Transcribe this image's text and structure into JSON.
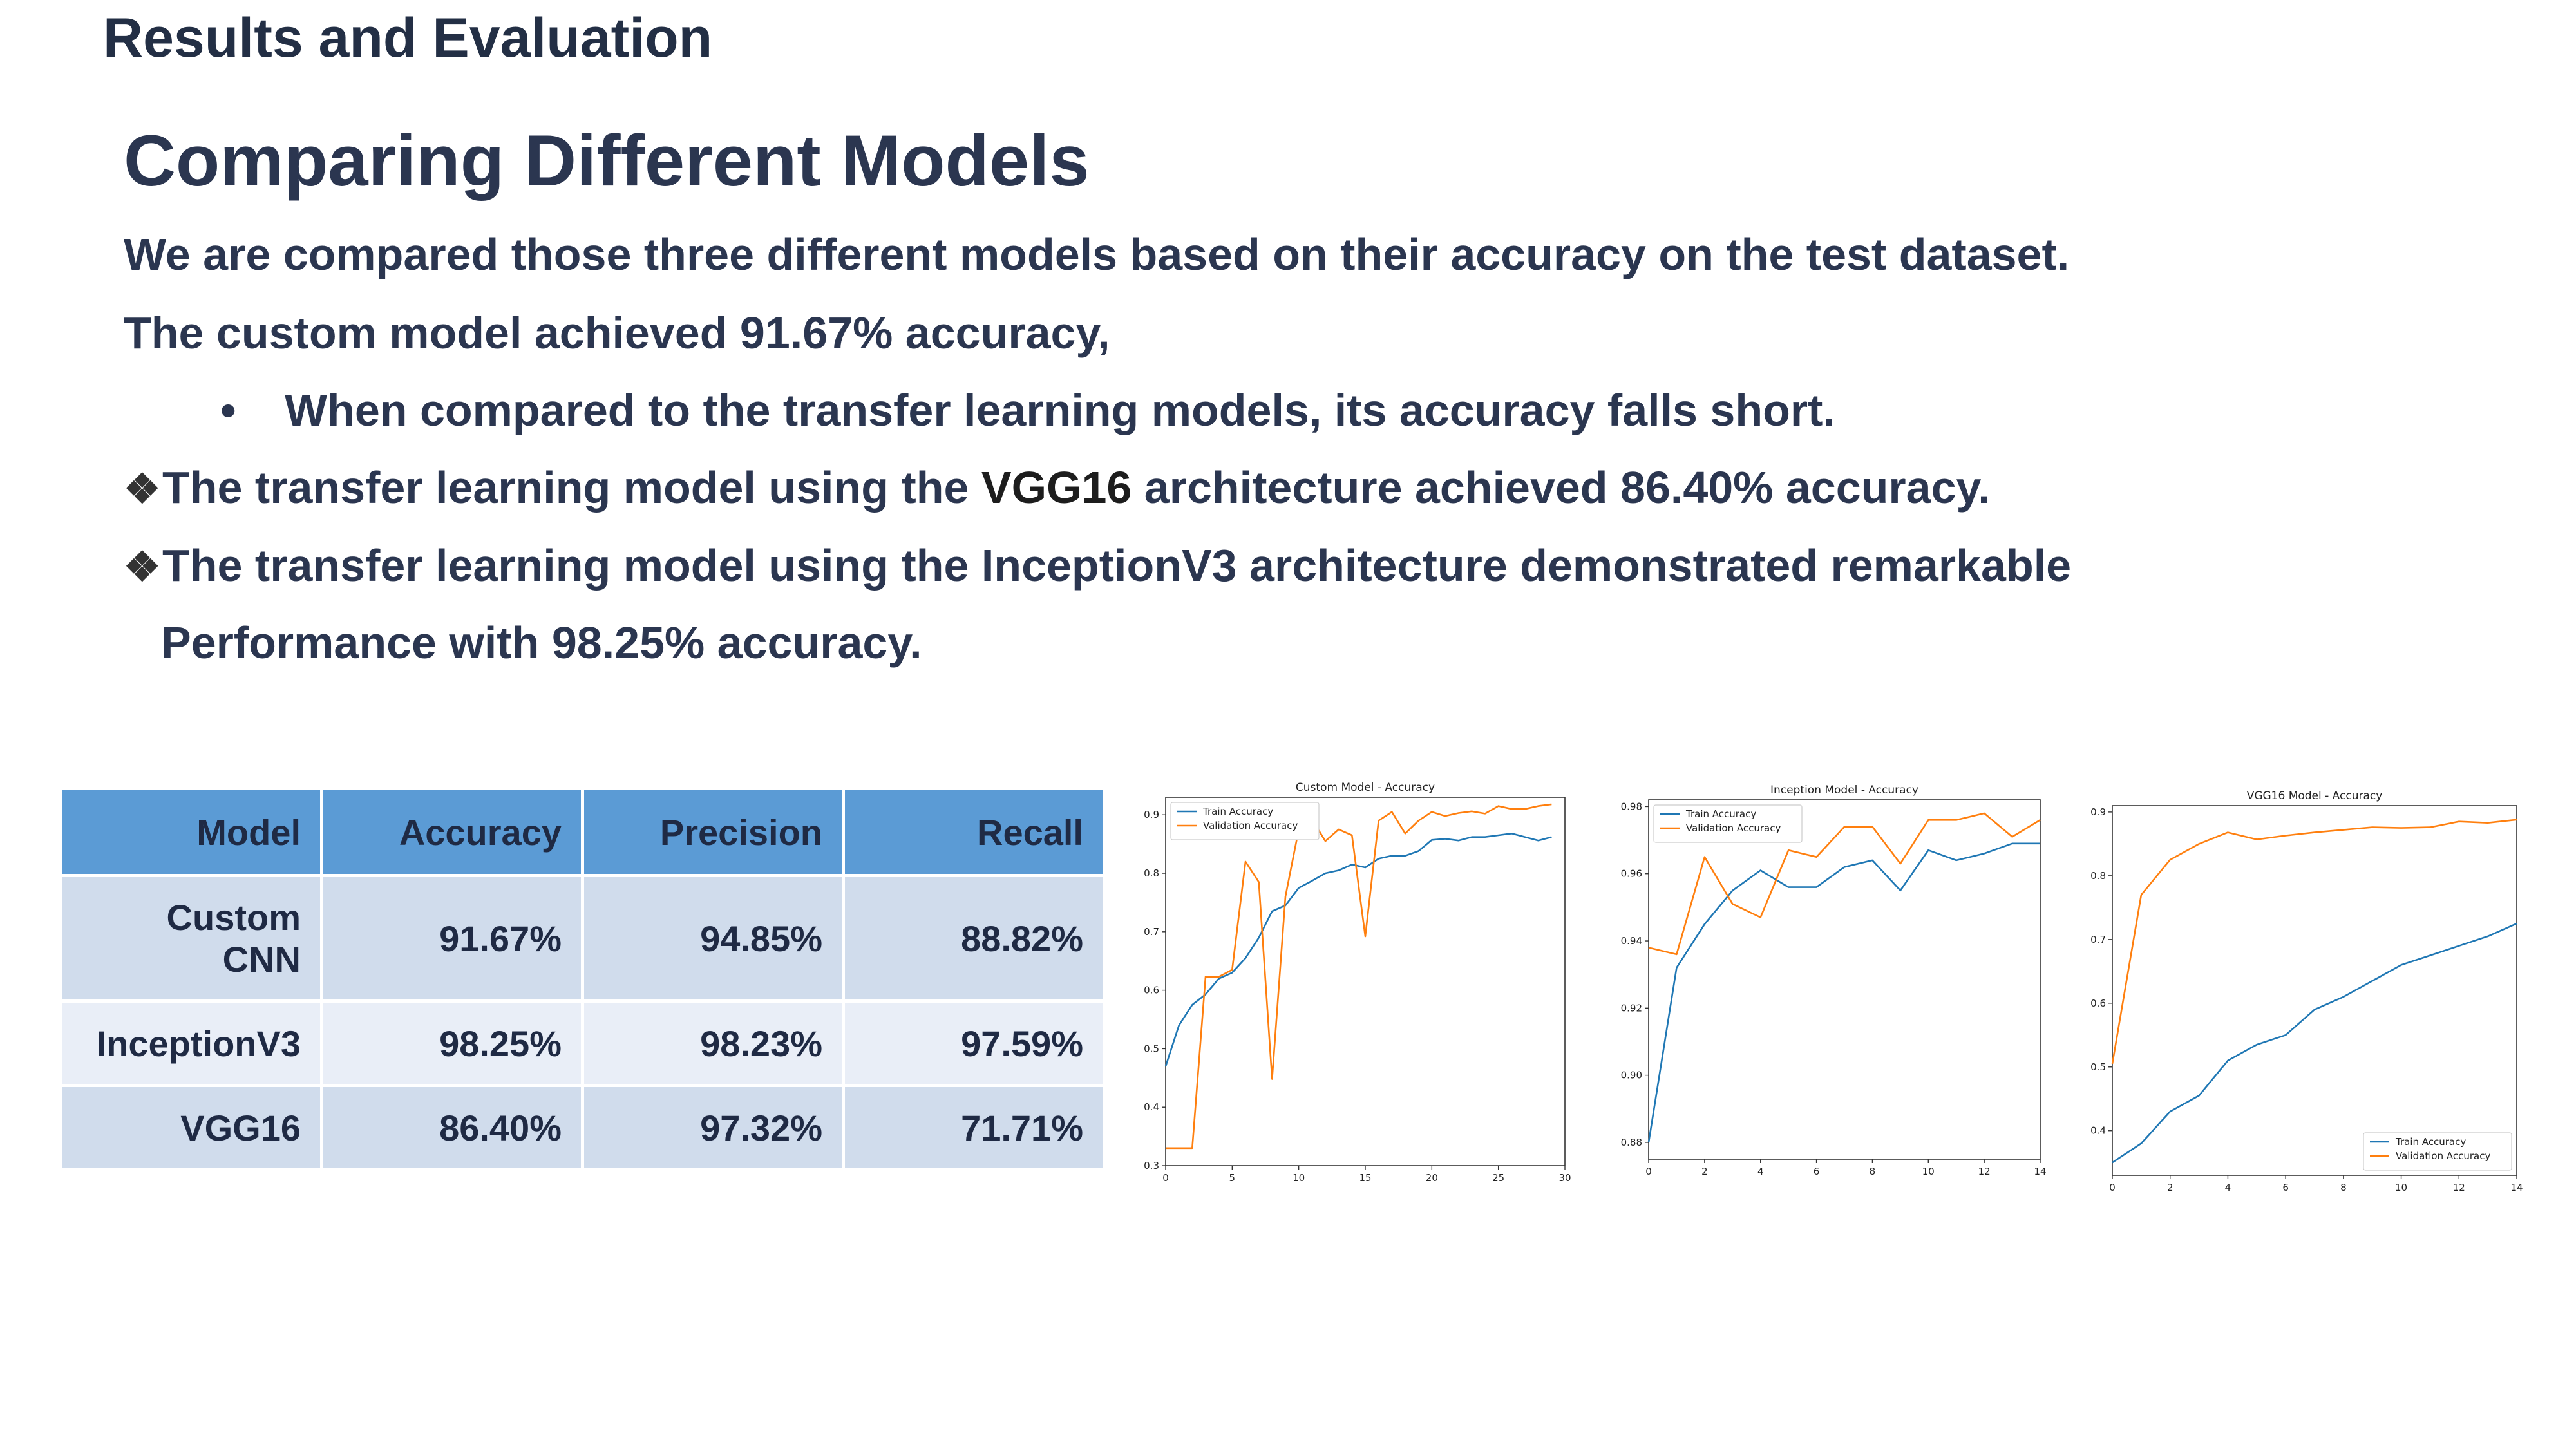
{
  "section_title": "Results and Evaluation",
  "heading": "Comparing Different Models",
  "lines": {
    "l1": "We are compared those three  different models based on their accuracy on the test dataset.",
    "l2": "The custom model achieved 91.67% accuracy,",
    "l3_bullet": "•",
    "l3": "When compared to the transfer learning models, its accuracy falls short.",
    "diamond": "❖",
    "l4_pre": "The transfer learning model using the ",
    "l4_bold": "VGG16",
    "l4_post": " architecture achieved 86.40% accuracy.",
    "l5": "The transfer learning model using the InceptionV3 architecture demonstrated remarkable",
    "l6": "Performance with 98.25% accuracy."
  },
  "table": {
    "headers": [
      "Model",
      "Accuracy",
      "Precision",
      "Recall"
    ],
    "rows": [
      [
        "Custom CNN",
        "91.67%",
        "94.85%",
        "88.82%"
      ],
      [
        "InceptionV3",
        "98.25%",
        "98.23%",
        "97.59%"
      ],
      [
        "VGG16",
        "86.40%",
        "97.32%",
        "71.71%"
      ]
    ]
  },
  "colors": {
    "train": "#1f77b4",
    "validation": "#ff7f0e",
    "header_fill": "#5b9bd5"
  },
  "chart_data": [
    {
      "type": "line",
      "title": "Custom Model - Accuracy",
      "xlim": [
        0,
        30
      ],
      "ylim": [
        0.3,
        0.93
      ],
      "xticks": [
        0,
        5,
        10,
        15,
        20,
        25,
        30
      ],
      "yticks": [
        0.3,
        0.4,
        0.5,
        0.6,
        0.7,
        0.8,
        0.9
      ],
      "ytick_labels": [
        "0.3",
        "0.4",
        "0.5",
        "0.6",
        "0.7",
        "0.8",
        "0.9"
      ],
      "legend_position": "top-left",
      "x": [
        0,
        1,
        2,
        3,
        4,
        5,
        6,
        7,
        8,
        9,
        10,
        11,
        12,
        13,
        14,
        15,
        16,
        17,
        18,
        19,
        20,
        21,
        22,
        23,
        24,
        25,
        26,
        27,
        28,
        29
      ],
      "series": [
        {
          "name": "Train Accuracy",
          "values": [
            0.47,
            0.54,
            0.575,
            0.593,
            0.62,
            0.63,
            0.655,
            0.69,
            0.735,
            0.745,
            0.775,
            0.787,
            0.8,
            0.805,
            0.815,
            0.81,
            0.825,
            0.83,
            0.83,
            0.838,
            0.857,
            0.859,
            0.856,
            0.862,
            0.862,
            0.865,
            0.868,
            0.862,
            0.856,
            0.862
          ]
        },
        {
          "name": "Validation Accuracy",
          "values": [
            0.33,
            0.33,
            0.33,
            0.623,
            0.623,
            0.635,
            0.82,
            0.785,
            0.448,
            0.76,
            0.875,
            0.892,
            0.855,
            0.875,
            0.865,
            0.692,
            0.89,
            0.905,
            0.868,
            0.89,
            0.905,
            0.898,
            0.903,
            0.906,
            0.902,
            0.915,
            0.91,
            0.91,
            0.915,
            0.918
          ]
        }
      ]
    },
    {
      "type": "line",
      "title": "Inception Model - Accuracy",
      "xlim": [
        0,
        14
      ],
      "ylim": [
        0.875,
        0.982
      ],
      "xticks": [
        0,
        2,
        4,
        6,
        8,
        10,
        12,
        14
      ],
      "yticks": [
        0.88,
        0.9,
        0.92,
        0.94,
        0.96,
        0.98
      ],
      "ytick_labels": [
        "0.88",
        "0.90",
        "0.92",
        "0.94",
        "0.96",
        "0.98"
      ],
      "legend_position": "top-left",
      "x": [
        0,
        1,
        2,
        3,
        4,
        5,
        6,
        7,
        8,
        9,
        10,
        11,
        12,
        13,
        14
      ],
      "series": [
        {
          "name": "Train Accuracy",
          "values": [
            0.88,
            0.932,
            0.945,
            0.955,
            0.961,
            0.956,
            0.956,
            0.962,
            0.964,
            0.955,
            0.967,
            0.964,
            0.966,
            0.969,
            0.969
          ]
        },
        {
          "name": "Validation Accuracy",
          "values": [
            0.938,
            0.936,
            0.965,
            0.951,
            0.947,
            0.967,
            0.965,
            0.974,
            0.974,
            0.963,
            0.976,
            0.976,
            0.978,
            0.971,
            0.976
          ]
        }
      ]
    },
    {
      "type": "line",
      "title": "VGG16 Model - Accuracy",
      "xlim": [
        0,
        14
      ],
      "ylim": [
        0.33,
        0.91
      ],
      "xticks": [
        0,
        2,
        4,
        6,
        8,
        10,
        12,
        14
      ],
      "yticks": [
        0.4,
        0.5,
        0.6,
        0.7,
        0.8,
        0.9
      ],
      "ytick_labels": [
        "0.4",
        "0.5",
        "0.6",
        "0.7",
        "0.8",
        "0.9"
      ],
      "legend_position": "bottom-right",
      "x": [
        0,
        1,
        2,
        3,
        4,
        5,
        6,
        7,
        8,
        9,
        10,
        11,
        12,
        13,
        14
      ],
      "series": [
        {
          "name": "Train Accuracy",
          "values": [
            0.35,
            0.38,
            0.43,
            0.455,
            0.51,
            0.535,
            0.55,
            0.59,
            0.61,
            0.635,
            0.66,
            0.675,
            0.69,
            0.705,
            0.725
          ]
        },
        {
          "name": "Validation Accuracy",
          "values": [
            0.505,
            0.77,
            0.825,
            0.85,
            0.868,
            0.857,
            0.863,
            0.868,
            0.872,
            0.876,
            0.875,
            0.876,
            0.885,
            0.883,
            0.888
          ]
        }
      ]
    }
  ]
}
